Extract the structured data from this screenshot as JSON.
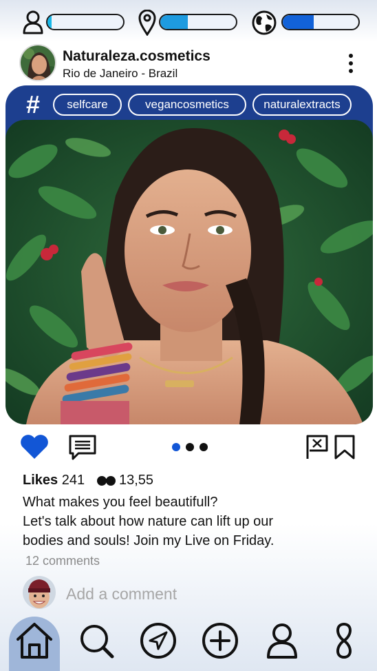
{
  "status_bar": {
    "meters": [
      {
        "icon": "user-icon",
        "level": 0.05,
        "color": "#19b8e8"
      },
      {
        "icon": "location-pin-icon",
        "level": 0.36,
        "color": "#1e9be0"
      },
      {
        "icon": "globe-icon",
        "level": 0.41,
        "color": "#1262d8"
      }
    ]
  },
  "post": {
    "account_name": "Naturaleza.cosmetics",
    "location": "Rio de Janeiro - Brazil",
    "hashtag_symbol": "#",
    "tags": [
      "selfcare",
      "vegancosmetics",
      "naturalextracts"
    ],
    "image_alt": "Woman with braided dark hair posing among green plants",
    "carousel": {
      "count": 3,
      "active_index": 0
    },
    "likes_label": "Likes",
    "likes_count": "241",
    "views_count": "13,55",
    "caption_lines": [
      "What makes you feel beautifull?",
      "Let's talk about how nature can lift up our",
      "bodies and souls! Join my Live on Friday."
    ],
    "comments_count": "12 comments",
    "comment_placeholder": "Add a comment"
  },
  "colors": {
    "accent": "#1d3f8f",
    "like": "#1256d6",
    "nav_active": "#9fb6d9"
  },
  "bottom_nav": [
    {
      "icon": "home-icon",
      "active": true
    },
    {
      "icon": "search-icon",
      "active": false
    },
    {
      "icon": "send-icon",
      "active": false
    },
    {
      "icon": "add-icon",
      "active": false
    },
    {
      "icon": "profile-icon",
      "active": false
    },
    {
      "icon": "infinity-icon",
      "active": false
    }
  ]
}
